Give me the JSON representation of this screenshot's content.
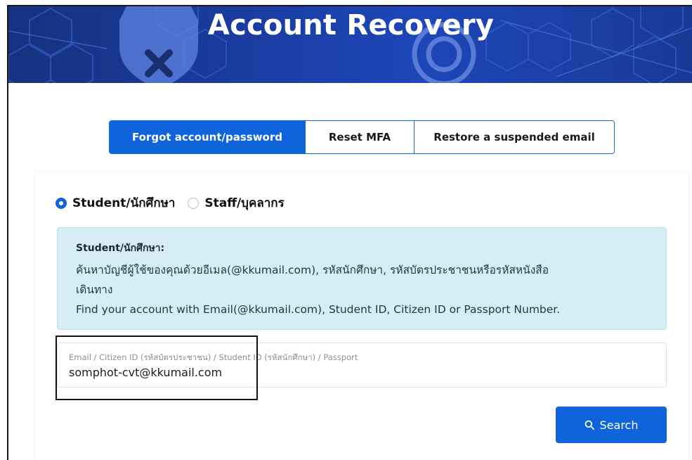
{
  "banner": {
    "title": "Account Recovery"
  },
  "tabs": [
    {
      "label": "Forgot account/password",
      "active": true
    },
    {
      "label": "Reset MFA",
      "active": false
    },
    {
      "label": "Restore a suspended email",
      "active": false
    }
  ],
  "user_type": {
    "options": [
      {
        "label": "Student/นักศึกษา",
        "checked": true
      },
      {
        "label": "Staff/บุคลากร",
        "checked": false
      }
    ]
  },
  "info": {
    "heading": "Student/นักศึกษา:",
    "line_th": "ค้นหาบัญชีผู้ใช้ของคุณด้วยอีเมล(@kkumail.com), รหัสนักศึกษา, รหัสบัตรประชาชนหรือรหัสหนังสือ",
    "line_th_cont": "เดินทาง",
    "line_en": "Find your account with Email(@kkumail.com), Student ID, Citizen ID or Passport Number."
  },
  "search_field": {
    "label": "Email / Citizen ID (รหัสบัตรประชาชน) / Student ID (รหัสนักศึกษา) / Passport",
    "value": "somphot-cvt@kkumail.com"
  },
  "search_button": {
    "label": "Search"
  },
  "colors": {
    "primary": "#0f64dc",
    "banner": "#1b3ea6",
    "info_bg": "#d6eef3"
  },
  "icons": {
    "banner_shield": "shield-x-icon",
    "search": "magnifier-icon"
  }
}
